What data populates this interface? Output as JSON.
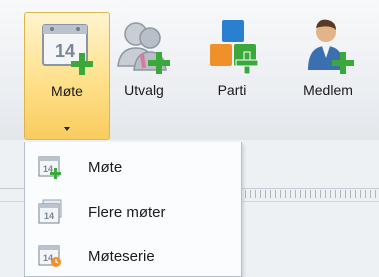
{
  "ribbon": {
    "buttons": [
      {
        "label": "Møte",
        "icon": "calendar-add-icon",
        "active": true
      },
      {
        "label": "Utvalg",
        "icon": "group-add-icon"
      },
      {
        "label": "Parti",
        "icon": "party-blocks-add-icon"
      },
      {
        "label": "Medlem",
        "icon": "person-add-icon"
      }
    ]
  },
  "calendar_day": "14",
  "menu": {
    "items": [
      {
        "label": "Møte",
        "icon": "calendar-add-icon"
      },
      {
        "label": "Flere møter",
        "icon": "calendar-multiple-icon"
      },
      {
        "label": "Møteserie",
        "icon": "calendar-series-icon"
      }
    ]
  },
  "colors": {
    "active_highlight": "#ffe08a",
    "plus_green": "#3aa83a",
    "parti_blue": "#2a7fd0",
    "parti_orange": "#f0902a"
  }
}
